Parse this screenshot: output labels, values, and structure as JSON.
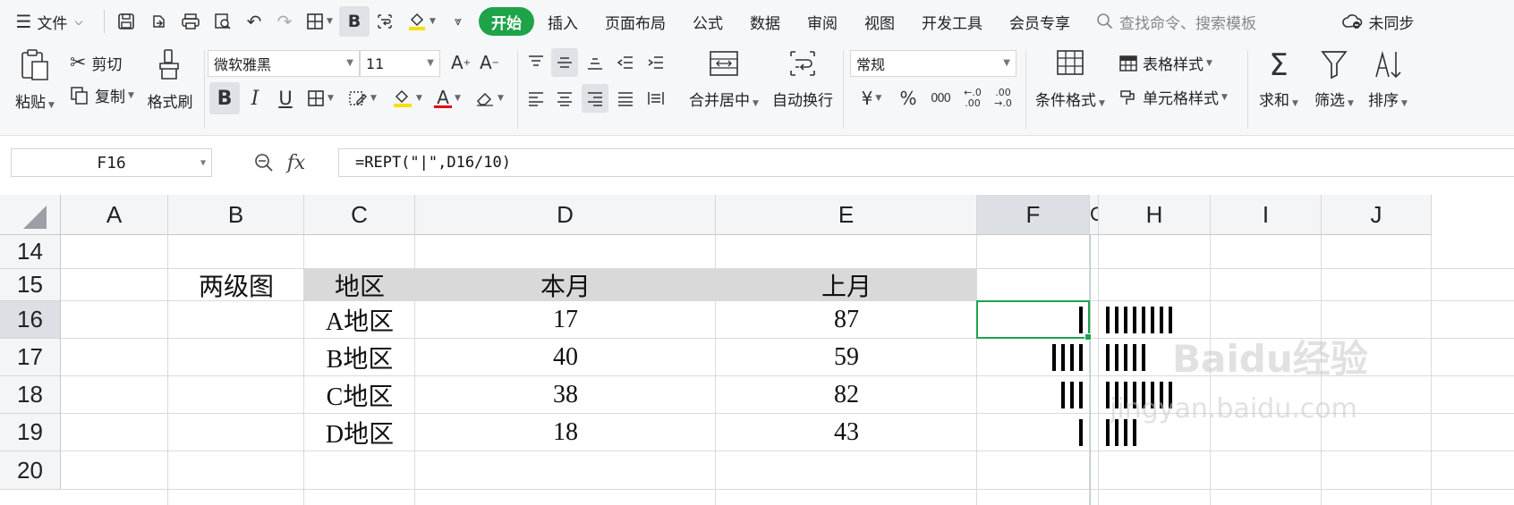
{
  "menubar": {
    "file_menu": "文件",
    "tabs": [
      "开始",
      "插入",
      "页面布局",
      "公式",
      "数据",
      "审阅",
      "视图",
      "开发工具",
      "会员专享"
    ],
    "search_placeholder": "查找命令、搜索模板",
    "sync_status": "未同步",
    "accent_color": "#1fa34a"
  },
  "ribbon": {
    "paste": "粘贴",
    "cut": "剪切",
    "copy": "复制",
    "format_painter": "格式刷",
    "font_name": "微软雅黑",
    "font_size": "11",
    "number_format": "常规",
    "merge_center": "合并居中",
    "wrap_text": "自动换行",
    "conditional_format": "条件格式",
    "table_style": "表格样式",
    "cell_style": "单元格样式",
    "sum": "求和",
    "filter": "筛选",
    "sort": "排序",
    "currency_symbol": "¥",
    "percent_symbol": "%",
    "thousands_symbol": "000",
    "inc_decimal": "←.0 .00",
    "dec_decimal": ".00 →.0"
  },
  "formulabar": {
    "cell_ref": "F16",
    "fx_label": "fx",
    "formula": "=REPT(\"|\",D16/10)"
  },
  "grid": {
    "columns": [
      "A",
      "B",
      "C",
      "D",
      "E",
      "F",
      "G",
      "H",
      "I",
      "J"
    ],
    "rows": [
      "14",
      "15",
      "16",
      "17",
      "18",
      "19",
      "20"
    ],
    "selected_column": "F",
    "selected_row": "16",
    "label_cell": "两级图",
    "header": {
      "region": "地区",
      "this_month": "本月",
      "last_month": "上月"
    },
    "data_rows": [
      {
        "region": "A地区",
        "this_month": 17,
        "last_month": 87
      },
      {
        "region": "B地区",
        "this_month": 40,
        "last_month": 59
      },
      {
        "region": "C地区",
        "this_month": 38,
        "last_month": 82
      },
      {
        "region": "D地区",
        "this_month": 18,
        "last_month": 43
      }
    ],
    "header_fill": "#d9d9d9"
  },
  "watermark": {
    "brand": "Baidu经验",
    "url": "jingyan.baidu.com"
  }
}
